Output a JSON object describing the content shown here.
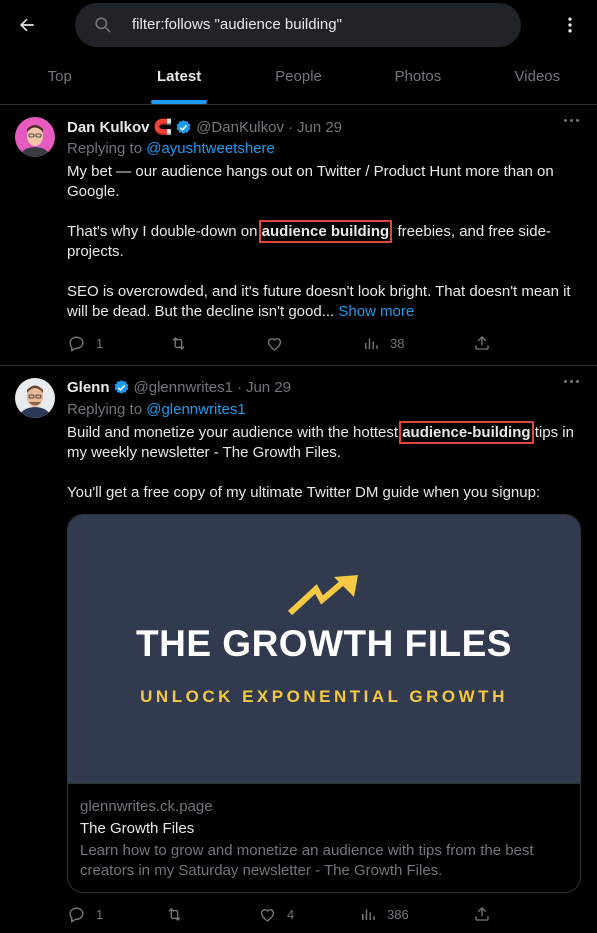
{
  "search": {
    "query": "filter:follows \"audience building\""
  },
  "tabs": [
    "Top",
    "Latest",
    "People",
    "Photos",
    "Videos"
  ],
  "colors": {
    "accent": "#1d9bf0",
    "highlight_box": "#e0463a",
    "card_bg": "#313a4e",
    "card_subtitle": "#f5c944"
  },
  "tweets": [
    {
      "name": "Dan Kulkov",
      "emoji": "🧲",
      "handle": "@DanKulkov",
      "sep": "·",
      "date": "Jun 29",
      "replying_prefix": "Replying to ",
      "replying_to": "@ayushtweetshere",
      "p1": "My bet — our audience hangs out on Twitter / Product Hunt more than on Google.",
      "p2_a": "That's why I double-down on ",
      "p2_hl": "audience building",
      "p2_b": ", freebies, and free side-projects.",
      "p3": "SEO is overcrowded, and it's future doesn't look bright. That doesn't mean it will be dead. But the decline isn't good... ",
      "show_more": "Show more",
      "replies": "1",
      "retweets": "",
      "likes": "",
      "views": "38"
    },
    {
      "name": "Glenn",
      "handle": "@glennwrites1",
      "sep": "·",
      "date": "Jun 29",
      "replying_prefix": "Replying to ",
      "replying_to": "@glennwrites1",
      "p1_a": "Build and monetize your audience with the hottest ",
      "p1_hl": "audience-building",
      "p1_b": " tips in my weekly newsletter - The Growth Files.",
      "p2": "You'll get a free copy of my ultimate Twitter DM guide when you signup:",
      "card": {
        "headline": "THE GROWTH FILES",
        "subline": "UNLOCK EXPONENTIAL GROWTH",
        "domain": "glennwrites.ck.page",
        "title": "The Growth Files",
        "description": "Learn how to grow and monetize an audience with tips from the best creators in my Saturday newsletter - The Growth Files."
      },
      "replies": "1",
      "retweets": "",
      "likes": "4",
      "views": "386"
    }
  ]
}
